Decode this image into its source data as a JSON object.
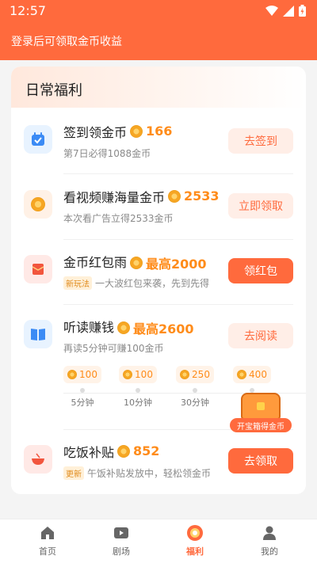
{
  "status_bar": {
    "time": "12:57"
  },
  "header": {
    "login_prompt": "登录后可领取金币收益"
  },
  "section": {
    "title": "日常福利"
  },
  "tasks": [
    {
      "name": "签到领金币",
      "reward": "166",
      "desc": "第7日必得1088金币",
      "button": "去签到",
      "icon": "calendar-check-icon"
    },
    {
      "name": "看视频赚海量金币",
      "reward": "2533",
      "desc": "本次看广告立得2533金币",
      "button": "立即领取",
      "icon": "video-coin-icon"
    },
    {
      "name": "金币红包雨",
      "reward": "最高2000",
      "tag": "新玩法",
      "desc": "一大波红包来袭，先到先得",
      "button": "领红包",
      "icon": "red-envelope-icon"
    },
    {
      "name": "听读赚钱",
      "reward": "最高2600",
      "desc": "再读5分钟可赚100金币",
      "button": "去阅读",
      "icon": "book-icon"
    },
    {
      "name": "吃饭补贴",
      "reward": "852",
      "tag": "更新",
      "desc": "午饭补贴发放中，轻松领金币",
      "button": "去领取",
      "icon": "rice-bowl-icon"
    }
  ],
  "reading_steps": [
    {
      "coins": "100",
      "label": "5分钟"
    },
    {
      "coins": "100",
      "label": "10分钟"
    },
    {
      "coins": "250",
      "label": "30分钟"
    },
    {
      "coins": "400",
      "label": ""
    }
  ],
  "treasure_chest": {
    "label": "开宝箱得金币"
  },
  "tab_bar": [
    {
      "label": "首页",
      "icon": "home-icon"
    },
    {
      "label": "剧场",
      "icon": "play-icon"
    },
    {
      "label": "福利",
      "icon": "welfare-icon",
      "active": true
    },
    {
      "label": "我的",
      "icon": "profile-icon"
    }
  ],
  "colors": {
    "brand": "#ff6a3d",
    "coin": "#ff8c1a"
  }
}
